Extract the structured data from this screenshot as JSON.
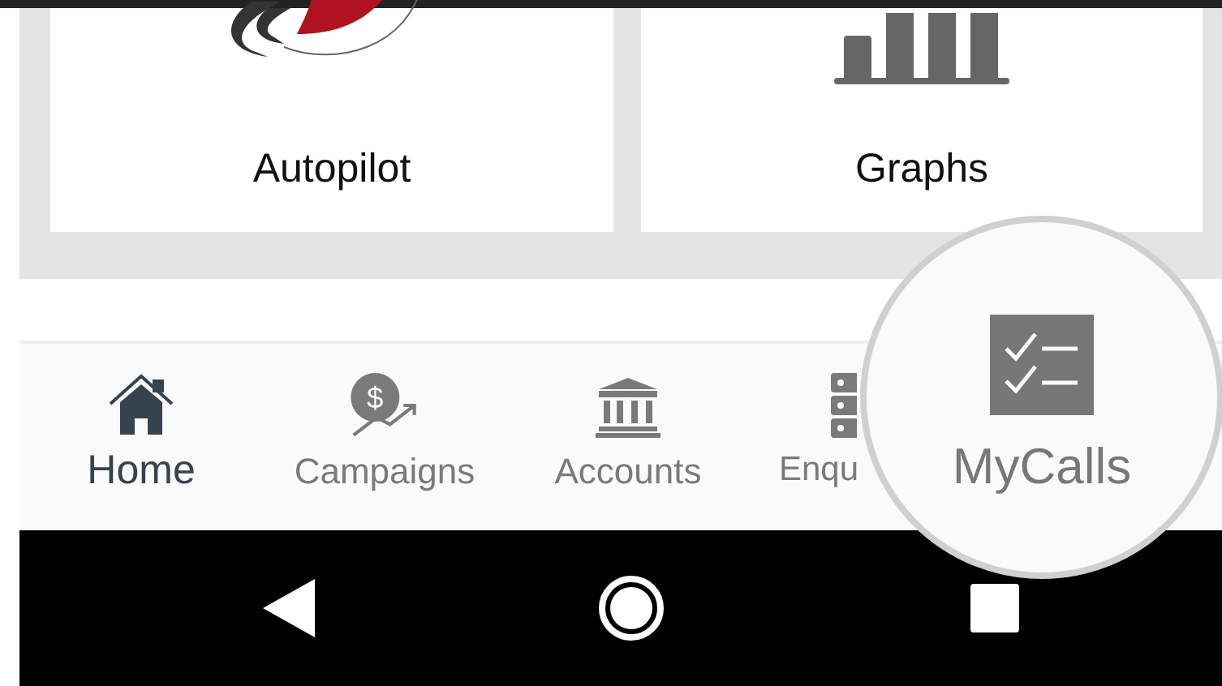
{
  "cards": [
    {
      "label": "Autopilot"
    },
    {
      "label": "Graphs"
    }
  ],
  "bottom_nav": [
    {
      "label": "Home",
      "selected": true
    },
    {
      "label": "Campaigns",
      "selected": false,
      "icon_text": "$"
    },
    {
      "label": "Accounts",
      "selected": false
    },
    {
      "label": "Enqu",
      "selected": false
    }
  ],
  "magnifier": {
    "label": "MyCalls",
    "selected": false
  }
}
